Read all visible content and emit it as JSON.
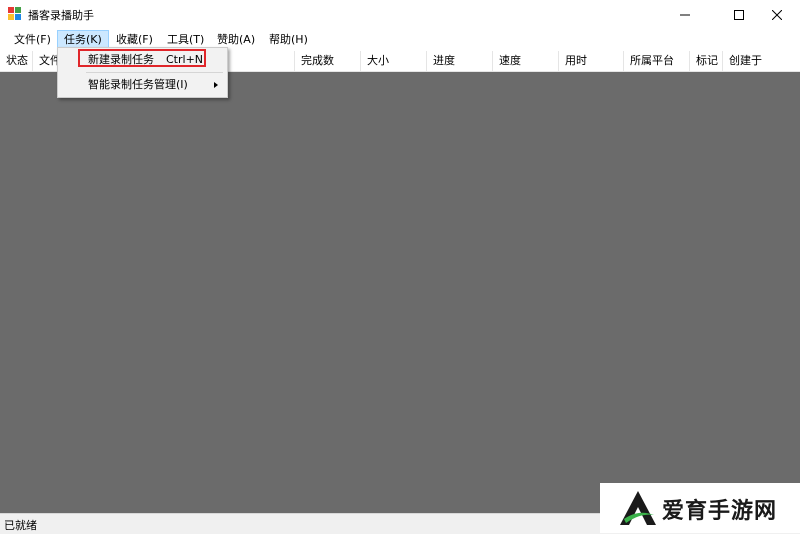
{
  "window": {
    "title": "播客录播助手",
    "controls": {
      "minimize": "minimize-icon",
      "maximize": "maximize-icon",
      "close": "close-icon"
    }
  },
  "menubar": {
    "items": [
      {
        "label": "文件(F)"
      },
      {
        "label": "任务(K)"
      },
      {
        "label": "收藏(F)"
      },
      {
        "label": "工具(T)"
      },
      {
        "label": "赞助(A)"
      },
      {
        "label": "帮助(H)"
      }
    ]
  },
  "task_menu": {
    "items": [
      {
        "label": "新建录制任务",
        "shortcut": "Ctrl+N"
      },
      {
        "label": "智能录制任务管理(I)",
        "submenu_icon": "chevron-right-icon"
      }
    ]
  },
  "table": {
    "columns": [
      "状态",
      "文件",
      "完成数",
      "大小",
      "进度",
      "速度",
      "用时",
      "所属平台",
      "标记",
      "创建于"
    ]
  },
  "status_bar": {
    "text": "已就绪"
  },
  "watermark": {
    "text": "爱育手游网",
    "logo_icon": "letter-a-logo-icon"
  },
  "colors": {
    "content_bg": "#6b6b6b",
    "highlight": "#e0262a",
    "menu_open_bg": "#cce8ff"
  }
}
